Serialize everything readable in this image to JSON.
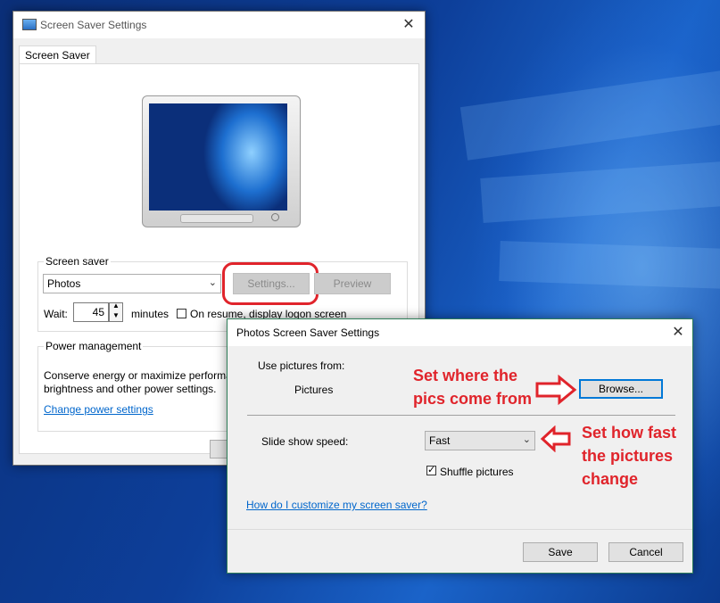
{
  "main_dialog": {
    "title": "Screen Saver Settings",
    "close_glyph": "✕",
    "tab_label": "Screen Saver",
    "screen_saver_group": "Screen saver",
    "screensaver_value": "Photos",
    "settings_button": "Settings...",
    "preview_button": "Preview",
    "wait_label": "Wait:",
    "wait_value": "45",
    "minutes_label": "minutes",
    "resume_label": "On resume, display logon screen",
    "power_group": "Power management",
    "power_text_1": "Conserve energy or maximize performa",
    "power_text_2": "brightness and other power settings.",
    "power_link": "Change power settings"
  },
  "photos_dialog": {
    "title": "Photos Screen Saver Settings",
    "close_glyph": "✕",
    "use_pictures_label": "Use pictures from:",
    "pictures_value": "Pictures",
    "browse_button": "Browse...",
    "speed_label": "Slide show speed:",
    "speed_value": "Fast",
    "shuffle_label": "Shuffle pictures",
    "shuffle_checked": true,
    "help_link": "How do I customize my screen saver?",
    "save_button": "Save",
    "cancel_button": "Cancel"
  },
  "annotations": {
    "browse_note_1": "Set where the",
    "browse_note_2": "pics come from",
    "speed_note_1": "Set how fast",
    "speed_note_2": "the pictures",
    "speed_note_3": "change"
  },
  "colors": {
    "annotation": "#e0242b",
    "link": "#0066cc",
    "focus": "#0078d7"
  }
}
